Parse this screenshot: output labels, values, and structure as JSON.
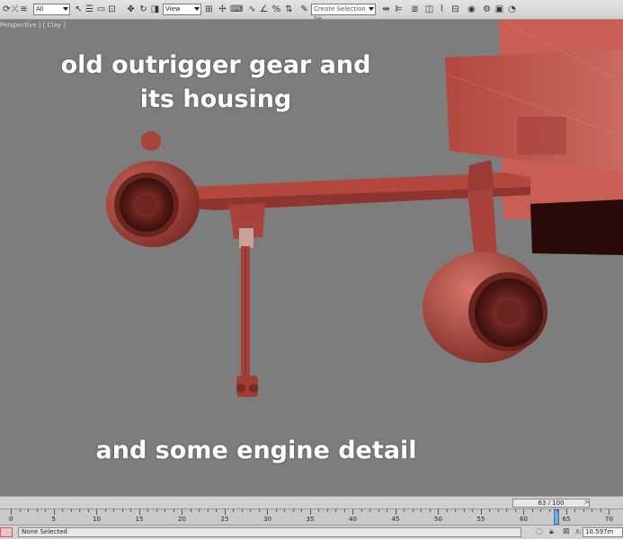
{
  "toolbar": {
    "selection_filter": "All",
    "reference_coord": "View",
    "named_selection_placeholder": "Create Selection Se"
  },
  "viewport": {
    "label": "Perspective ] [ Clay ]",
    "caption_top_line1": "old outrigger gear and",
    "caption_top_line2": "its housing",
    "caption_bottom": "and some engine detail"
  },
  "timeslider": {
    "frame_readout": "63 / 100",
    "prev": "<",
    "next": ">"
  },
  "ruler": {
    "labels": [
      "0",
      "5",
      "10",
      "15",
      "20",
      "25",
      "30",
      "35",
      "40",
      "45",
      "50",
      "55",
      "60",
      "65",
      "70"
    ]
  },
  "statusbar": {
    "selection_text": "None Selected",
    "x_label": "X:",
    "x_value": "10.597m"
  },
  "colors": {
    "model_red": "#b5463d",
    "viewport_bg": "#7d7d7d",
    "caption": "#ffffff"
  }
}
